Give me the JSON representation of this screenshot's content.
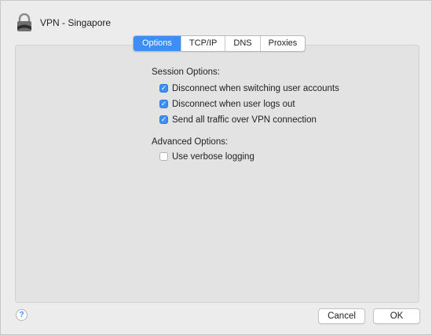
{
  "window": {
    "title": "VPN - Singapore"
  },
  "tabs": [
    {
      "label": "Options",
      "active": true
    },
    {
      "label": "TCP/IP",
      "active": false
    },
    {
      "label": "DNS",
      "active": false
    },
    {
      "label": "Proxies",
      "active": false
    }
  ],
  "session": {
    "label": "Session Options:",
    "options": [
      {
        "label": "Disconnect when switching user accounts",
        "checked": true
      },
      {
        "label": "Disconnect when user logs out",
        "checked": true
      },
      {
        "label": "Send all traffic over VPN connection",
        "checked": true
      }
    ]
  },
  "advanced": {
    "label": "Advanced Options:",
    "options": [
      {
        "label": "Use verbose logging",
        "checked": false
      }
    ]
  },
  "footer": {
    "help_symbol": "?",
    "cancel_label": "Cancel",
    "ok_label": "OK"
  },
  "colors": {
    "accent": "#3d8ff5",
    "window_bg": "#ececec",
    "panel_bg": "#e3e3e3"
  },
  "icons": {
    "vpn": "vpn-lock-icon",
    "check": "checkmark-icon",
    "help": "help-icon"
  }
}
